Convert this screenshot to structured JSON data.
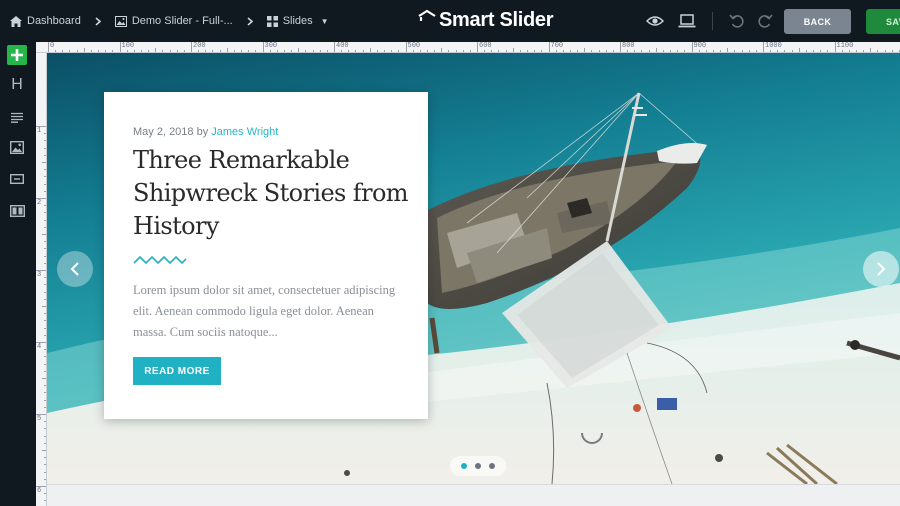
{
  "breadcrumb": {
    "dashboard": "Dashboard",
    "slider": "Demo Slider - Full-...",
    "slides": "Slides"
  },
  "app": {
    "logo_text": "Smart Slider"
  },
  "header_buttons": {
    "back": "BACK",
    "save": "SAVE"
  },
  "sidebar": {
    "items": [
      {
        "icon": "plus-icon"
      },
      {
        "icon": "heading-icon",
        "glyph": "H"
      },
      {
        "icon": "text-icon"
      },
      {
        "icon": "image-icon"
      },
      {
        "icon": "button-icon"
      },
      {
        "icon": "columns-icon"
      }
    ]
  },
  "ruler": {
    "top": [
      "0",
      "100",
      "200",
      "300",
      "400",
      "500",
      "600",
      "700",
      "800",
      "900",
      "1000",
      "1100"
    ],
    "left": [
      "1",
      "2",
      "3",
      "4",
      "5",
      "6"
    ]
  },
  "slide": {
    "date": "May 2, 2018 by ",
    "author": "James Wright",
    "title": "Three Remarkable Shipwreck Stories from History",
    "excerpt": "Lorem ipsum dolor sit amet, consectetuer adipiscing elit. Aenean commodo ligula eget dolor. Aenean massa. Cum sociis natoque...",
    "cta": "READ MORE"
  },
  "bullets": {
    "count": 3,
    "active": 0
  },
  "colors": {
    "accent": "#21b1c4",
    "save": "#1f8a3c",
    "add": "#25b54b",
    "topbar": "#101820"
  }
}
